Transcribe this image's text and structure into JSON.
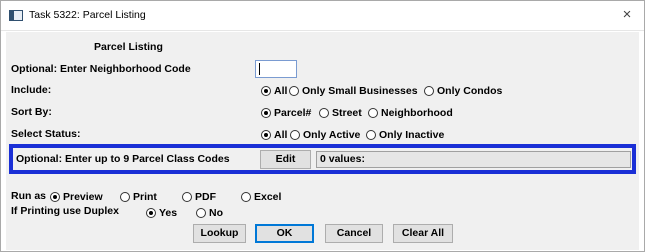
{
  "window": {
    "title": "Task 5322: Parcel Listing",
    "close_label": "×"
  },
  "form": {
    "heading": "Parcel Listing",
    "neighborhood": {
      "label": "Optional: Enter Neighborhood Code",
      "value": ""
    },
    "include": {
      "label": "Include:",
      "options": [
        "All",
        "Only Small Businesses",
        "Only Condos"
      ],
      "selected": "All"
    },
    "sort_by": {
      "label": "Sort By:",
      "options": [
        "Parcel#",
        "Street",
        "Neighborhood"
      ],
      "selected": "Parcel#"
    },
    "status": {
      "label": "Select Status:",
      "options": [
        "All",
        "Only Active",
        "Only Inactive"
      ],
      "selected": "All"
    },
    "parcel_class": {
      "label": "Optional: Enter up to 9 Parcel Class Codes",
      "edit_label": "Edit",
      "values_text": "0 values:"
    },
    "run_as": {
      "label": "Run as",
      "options": [
        "Preview",
        "Print",
        "PDF",
        "Excel"
      ],
      "selected": "Preview"
    },
    "duplex": {
      "label": "If Printing use Duplex",
      "options": [
        "Yes",
        "No"
      ],
      "selected": "Yes"
    }
  },
  "buttons": {
    "lookup": "Lookup",
    "ok": "OK",
    "cancel": "Cancel",
    "clear_all": "Clear All"
  },
  "colors": {
    "highlight_border": "#1a2fd6",
    "dialog_bg": "#f0f0f0"
  }
}
